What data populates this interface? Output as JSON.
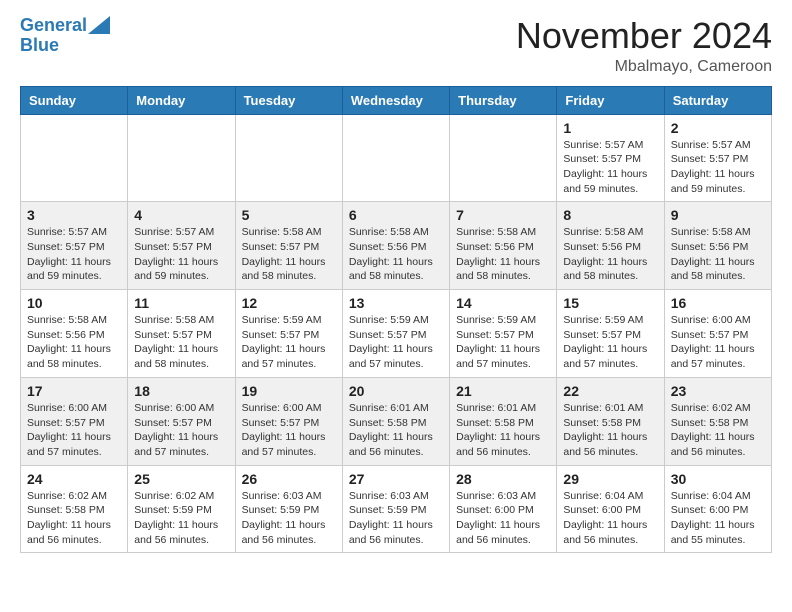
{
  "header": {
    "logo_line1": "General",
    "logo_line2": "Blue",
    "month": "November 2024",
    "location": "Mbalmayo, Cameroon"
  },
  "weekdays": [
    "Sunday",
    "Monday",
    "Tuesday",
    "Wednesday",
    "Thursday",
    "Friday",
    "Saturday"
  ],
  "weeks": [
    [
      {
        "day": "",
        "info": ""
      },
      {
        "day": "",
        "info": ""
      },
      {
        "day": "",
        "info": ""
      },
      {
        "day": "",
        "info": ""
      },
      {
        "day": "",
        "info": ""
      },
      {
        "day": "1",
        "info": "Sunrise: 5:57 AM\nSunset: 5:57 PM\nDaylight: 11 hours\nand 59 minutes."
      },
      {
        "day": "2",
        "info": "Sunrise: 5:57 AM\nSunset: 5:57 PM\nDaylight: 11 hours\nand 59 minutes."
      }
    ],
    [
      {
        "day": "3",
        "info": "Sunrise: 5:57 AM\nSunset: 5:57 PM\nDaylight: 11 hours\nand 59 minutes."
      },
      {
        "day": "4",
        "info": "Sunrise: 5:57 AM\nSunset: 5:57 PM\nDaylight: 11 hours\nand 59 minutes."
      },
      {
        "day": "5",
        "info": "Sunrise: 5:58 AM\nSunset: 5:57 PM\nDaylight: 11 hours\nand 58 minutes."
      },
      {
        "day": "6",
        "info": "Sunrise: 5:58 AM\nSunset: 5:56 PM\nDaylight: 11 hours\nand 58 minutes."
      },
      {
        "day": "7",
        "info": "Sunrise: 5:58 AM\nSunset: 5:56 PM\nDaylight: 11 hours\nand 58 minutes."
      },
      {
        "day": "8",
        "info": "Sunrise: 5:58 AM\nSunset: 5:56 PM\nDaylight: 11 hours\nand 58 minutes."
      },
      {
        "day": "9",
        "info": "Sunrise: 5:58 AM\nSunset: 5:56 PM\nDaylight: 11 hours\nand 58 minutes."
      }
    ],
    [
      {
        "day": "10",
        "info": "Sunrise: 5:58 AM\nSunset: 5:56 PM\nDaylight: 11 hours\nand 58 minutes."
      },
      {
        "day": "11",
        "info": "Sunrise: 5:58 AM\nSunset: 5:57 PM\nDaylight: 11 hours\nand 58 minutes."
      },
      {
        "day": "12",
        "info": "Sunrise: 5:59 AM\nSunset: 5:57 PM\nDaylight: 11 hours\nand 57 minutes."
      },
      {
        "day": "13",
        "info": "Sunrise: 5:59 AM\nSunset: 5:57 PM\nDaylight: 11 hours\nand 57 minutes."
      },
      {
        "day": "14",
        "info": "Sunrise: 5:59 AM\nSunset: 5:57 PM\nDaylight: 11 hours\nand 57 minutes."
      },
      {
        "day": "15",
        "info": "Sunrise: 5:59 AM\nSunset: 5:57 PM\nDaylight: 11 hours\nand 57 minutes."
      },
      {
        "day": "16",
        "info": "Sunrise: 6:00 AM\nSunset: 5:57 PM\nDaylight: 11 hours\nand 57 minutes."
      }
    ],
    [
      {
        "day": "17",
        "info": "Sunrise: 6:00 AM\nSunset: 5:57 PM\nDaylight: 11 hours\nand 57 minutes."
      },
      {
        "day": "18",
        "info": "Sunrise: 6:00 AM\nSunset: 5:57 PM\nDaylight: 11 hours\nand 57 minutes."
      },
      {
        "day": "19",
        "info": "Sunrise: 6:00 AM\nSunset: 5:57 PM\nDaylight: 11 hours\nand 57 minutes."
      },
      {
        "day": "20",
        "info": "Sunrise: 6:01 AM\nSunset: 5:58 PM\nDaylight: 11 hours\nand 56 minutes."
      },
      {
        "day": "21",
        "info": "Sunrise: 6:01 AM\nSunset: 5:58 PM\nDaylight: 11 hours\nand 56 minutes."
      },
      {
        "day": "22",
        "info": "Sunrise: 6:01 AM\nSunset: 5:58 PM\nDaylight: 11 hours\nand 56 minutes."
      },
      {
        "day": "23",
        "info": "Sunrise: 6:02 AM\nSunset: 5:58 PM\nDaylight: 11 hours\nand 56 minutes."
      }
    ],
    [
      {
        "day": "24",
        "info": "Sunrise: 6:02 AM\nSunset: 5:58 PM\nDaylight: 11 hours\nand 56 minutes."
      },
      {
        "day": "25",
        "info": "Sunrise: 6:02 AM\nSunset: 5:59 PM\nDaylight: 11 hours\nand 56 minutes."
      },
      {
        "day": "26",
        "info": "Sunrise: 6:03 AM\nSunset: 5:59 PM\nDaylight: 11 hours\nand 56 minutes."
      },
      {
        "day": "27",
        "info": "Sunrise: 6:03 AM\nSunset: 5:59 PM\nDaylight: 11 hours\nand 56 minutes."
      },
      {
        "day": "28",
        "info": "Sunrise: 6:03 AM\nSunset: 6:00 PM\nDaylight: 11 hours\nand 56 minutes."
      },
      {
        "day": "29",
        "info": "Sunrise: 6:04 AM\nSunset: 6:00 PM\nDaylight: 11 hours\nand 56 minutes."
      },
      {
        "day": "30",
        "info": "Sunrise: 6:04 AM\nSunset: 6:00 PM\nDaylight: 11 hours\nand 55 minutes."
      }
    ]
  ]
}
